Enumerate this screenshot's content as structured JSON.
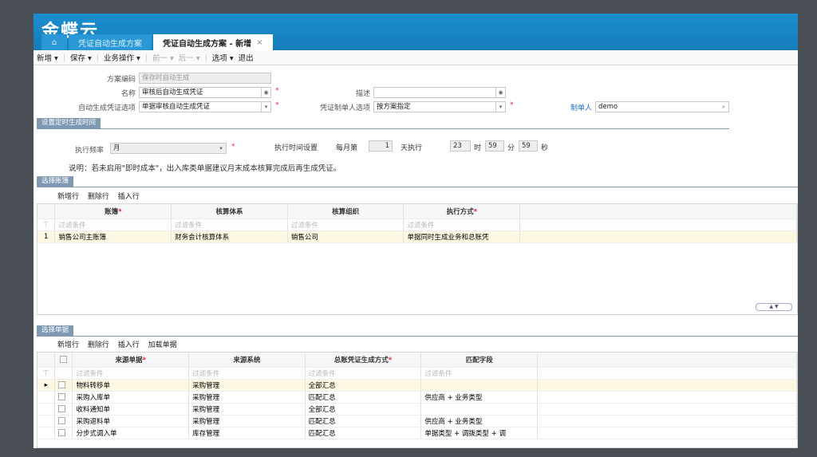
{
  "app": {
    "logo": "金蝶云"
  },
  "tabs": [
    {
      "label": "凭证自动生成方案"
    },
    {
      "label": "凭证自动生成方案 - 新增",
      "close": "×"
    }
  ],
  "toolbar": {
    "new": "新增 ▾",
    "save": "保存 ▾",
    "biz": "业务操作 ▾",
    "prev": "前一 ▾",
    "next": "后一 ▾",
    "options": "选项 ▾",
    "exit": "退出"
  },
  "form": {
    "code_label": "方案编码",
    "code_value": "保存时自动生成",
    "name_label": "名称",
    "name_value": "审核后自动生成凭证",
    "desc_label": "描述",
    "desc_value": "",
    "gen_label": "自动生成凭证选项",
    "gen_value": "单据审核自动生成凭证",
    "maker_opt_label": "凭证制单人选项",
    "maker_opt_value": "按方案指定",
    "maker_label": "制单人",
    "maker_value": "demo"
  },
  "schedule": {
    "section": "设置定时生成时间",
    "freq_label": "执行频率",
    "freq_value": "月",
    "time_label": "执行时间设置",
    "per_month": "每月第",
    "day": "1",
    "day_unit": "天执行",
    "hour": "23",
    "hour_unit": "时",
    "min": "59",
    "min_unit": "分",
    "sec": "59",
    "sec_unit": "秒",
    "note": "说明：若未启用\"即时成本\"，出入库类单据建议月末成本核算完成后再生成凭证。"
  },
  "books": {
    "section": "选择账簿",
    "actions": [
      "新增行",
      "删除行",
      "插入行"
    ],
    "columns": [
      "账簿",
      "核算体系",
      "核算组织",
      "执行方式"
    ],
    "required": [
      true,
      false,
      false,
      true
    ],
    "filter": "过滤条件",
    "rows": [
      {
        "no": "1",
        "cells": [
          "销售公司主账簿",
          "财务会计核算体系",
          "销售公司",
          "单据同时生成业务和总账凭"
        ]
      }
    ]
  },
  "docs": {
    "section": "选择单据",
    "actions": [
      "新增行",
      "删除行",
      "插入行",
      "加载单据"
    ],
    "columns": [
      "来源单据",
      "来源系统",
      "总账凭证生成方式",
      "匹配字段"
    ],
    "required": [
      true,
      false,
      true,
      false
    ],
    "filter": "过滤条件",
    "rows": [
      {
        "cells": [
          "物料转移单",
          "采购管理",
          "全部汇总",
          ""
        ]
      },
      {
        "cells": [
          "采购入库单",
          "采购管理",
          "匹配汇总",
          "供应商 + 业务类型"
        ]
      },
      {
        "cells": [
          "收料通知单",
          "采购管理",
          "全部汇总",
          ""
        ]
      },
      {
        "cells": [
          "采购退料单",
          "采购管理",
          "匹配汇总",
          "供应商 + 业务类型"
        ]
      },
      {
        "cells": [
          "分步式调入单",
          "库存管理",
          "匹配汇总",
          "单据类型 + 调拨类型 + 调"
        ]
      }
    ]
  },
  "icons": {
    "home": "home-icon",
    "lookup": "lookup-icon",
    "search": "search-icon"
  },
  "colors": {
    "topbar": "#1c8fd0",
    "section": "#7f99b3",
    "required": "#e23"
  }
}
